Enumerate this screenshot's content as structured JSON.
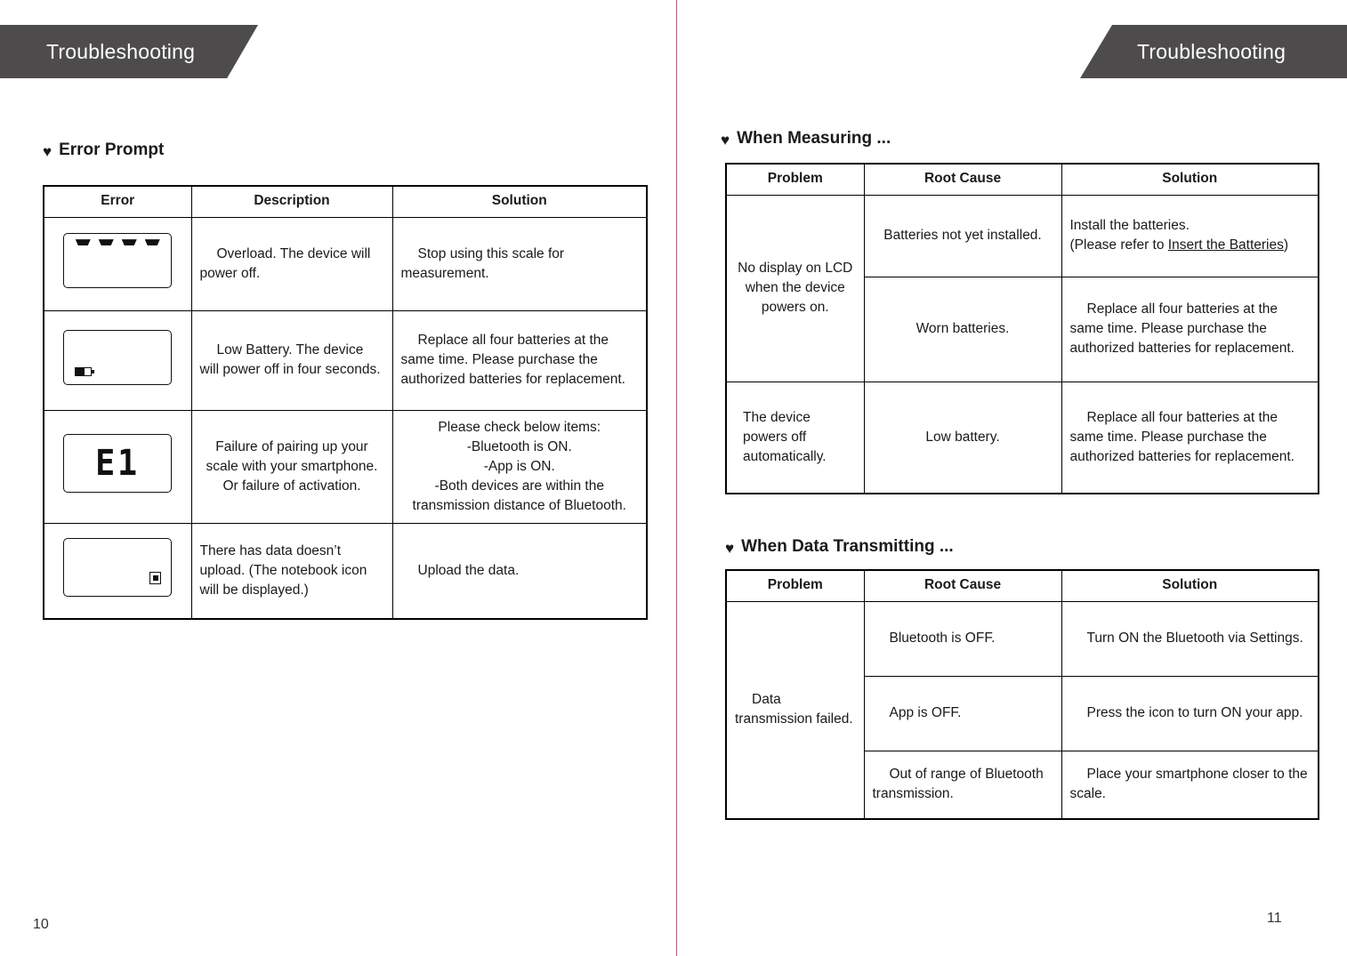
{
  "banner": {
    "left_title": "Troubleshooting",
    "right_title": "Troubleshooting"
  },
  "colors": {
    "banner_bg": "#4d4b4c",
    "gutter": "#e0457b",
    "table_border": "#000000",
    "text": "#1a1a1a"
  },
  "left_page": {
    "page_number": "10",
    "section": {
      "bullet": "heart-bullet-icon",
      "title": "Error Prompt"
    },
    "table": {
      "headers": [
        "Error",
        "Description",
        "Solution"
      ],
      "rows": [
        {
          "icon": "lcd-overload-dashes-icon",
          "description": "Overload. The device will power off.",
          "solution": "Stop using this scale for measurement."
        },
        {
          "icon": "lcd-low-battery-icon",
          "description": "Low Battery. The device will power off in four seconds.",
          "solution": "Replace all four batteries at the same time. Please purchase the authorized batteries for replacement."
        },
        {
          "icon": "lcd-e1-error-icon",
          "icon_text": "E1",
          "description_line1": "Failure of pairing up your scale with your smartphone.",
          "description_line2": "Or failure of activation.",
          "solution": "Please check below items:\n-Bluetooth is ON.\n-App is ON.\n -Both devices are within the transmission distance of Bluetooth."
        },
        {
          "icon": "lcd-notebook-icon",
          "description": "There has data doesn’t upload. (The notebook icon will be displayed.)",
          "solution": "Upload the data."
        }
      ]
    }
  },
  "right_page": {
    "page_number": "11",
    "measuring_section": {
      "bullet": "heart-bullet-icon",
      "title": "When Measuring ...",
      "table": {
        "headers": [
          "Problem",
          "Root Cause",
          "Solution"
        ],
        "rows": [
          {
            "problem": "No display on LCD when the device powers on.",
            "root_cause": "Batteries not yet installed.",
            "solution_before": "Install the batteries.\n (Please refer to ",
            "solution_link": "Insert the Batteries",
            "solution_after": ")"
          },
          {
            "root_cause": "Worn batteries.",
            "solution": "Replace all four batteries at the same time. Please purchase the authorized batteries for replacement."
          },
          {
            "problem": "The device powers off automatically.",
            "root_cause": "Low battery.",
            "solution": "Replace all four batteries at the same time. Please purchase the authorized batteries for replacement."
          }
        ]
      }
    },
    "transmitting_section": {
      "bullet": "heart-bullet-icon",
      "title": "When Data Transmitting ...",
      "table": {
        "headers": [
          "Problem",
          "Root Cause",
          "Solution"
        ],
        "problem": "Data transmission failed.",
        "rows": [
          {
            "root_cause": "Bluetooth is OFF.",
            "solution": "Turn ON the Bluetooth via Settings."
          },
          {
            "root_cause": "App is OFF.",
            "solution": "Press the icon to turn ON your app."
          },
          {
            "root_cause": "Out of range of Bluetooth transmission.",
            "solution": "Place your smartphone closer to the scale."
          }
        ]
      }
    }
  }
}
